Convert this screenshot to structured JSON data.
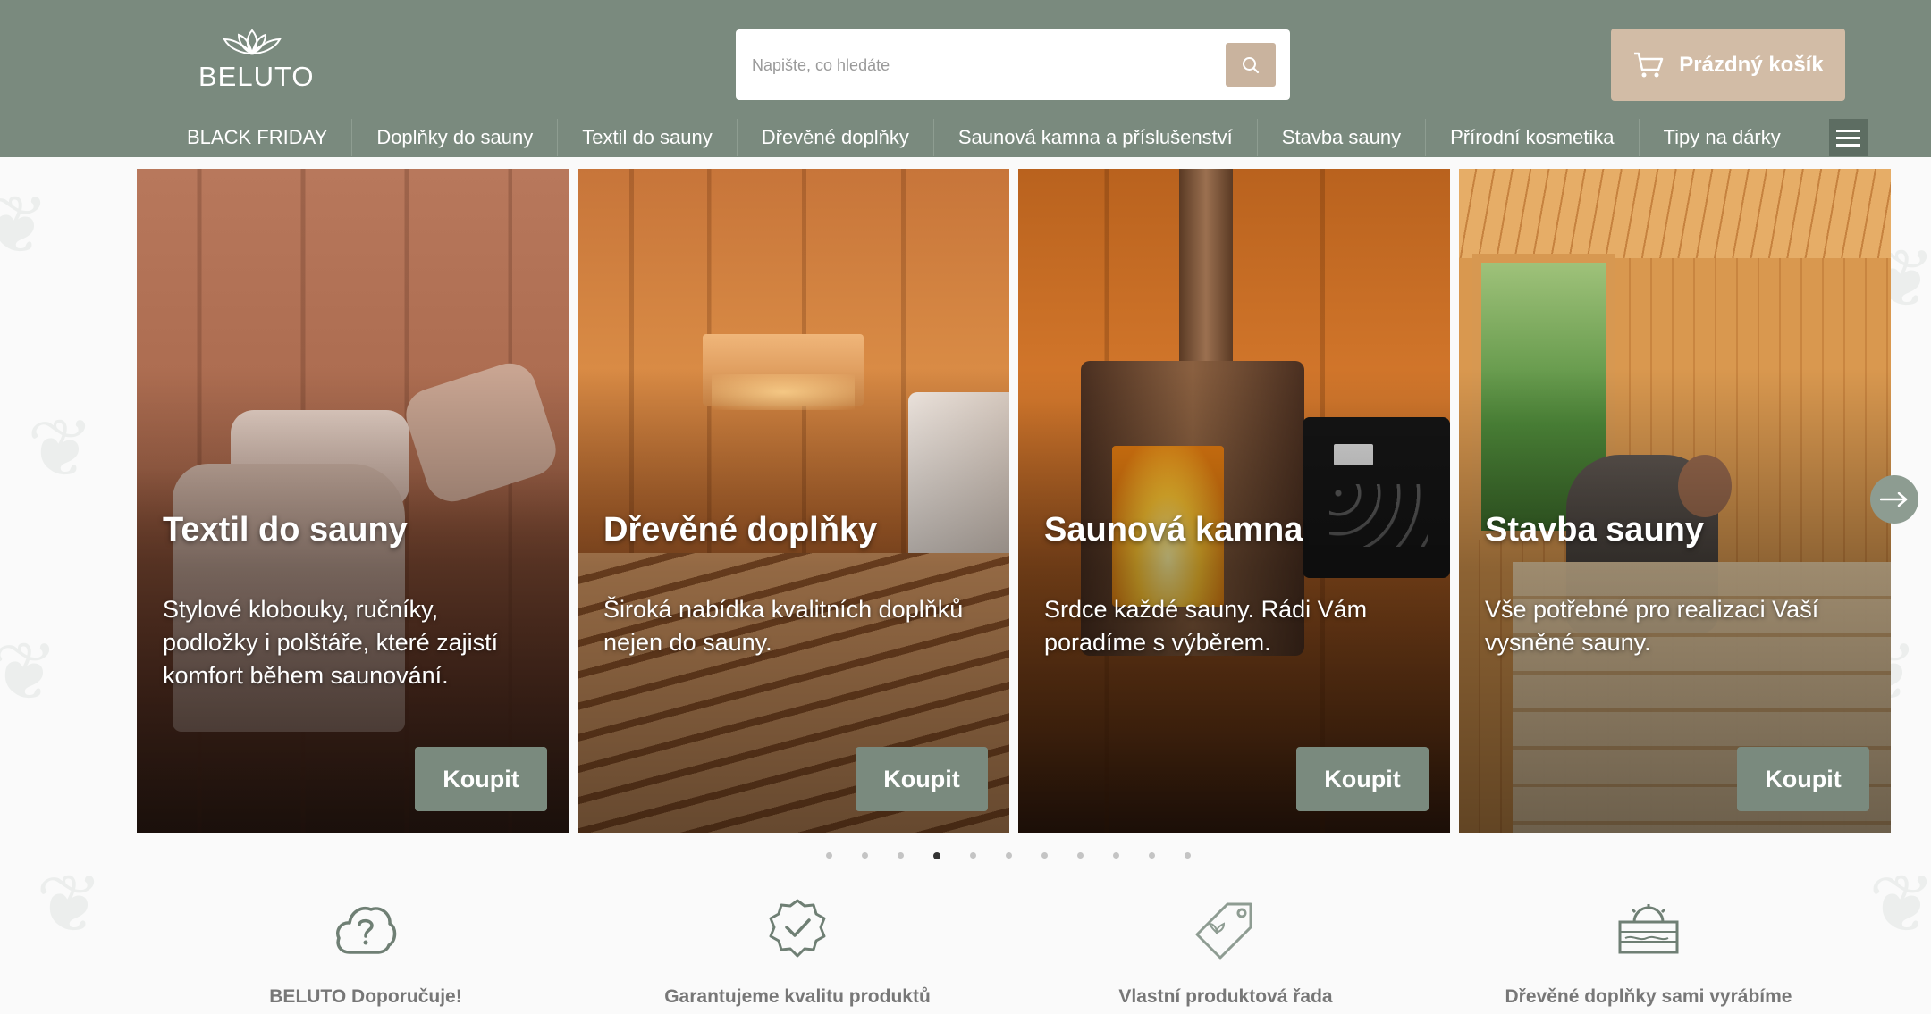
{
  "header": {
    "logo_text": "BELUTO",
    "search": {
      "placeholder": "Napište, co hledáte",
      "value": ""
    },
    "cart_label": "Prázdný košík"
  },
  "nav": {
    "items": [
      {
        "label": "BLACK FRIDAY"
      },
      {
        "label": "Doplňky do sauny"
      },
      {
        "label": "Textil do sauny"
      },
      {
        "label": "Dřevěné doplňky"
      },
      {
        "label": "Saunová kamna a příslušenství"
      },
      {
        "label": "Stavba sauny"
      },
      {
        "label": "Přírodní kosmetika"
      },
      {
        "label": "Tipy na dárky"
      }
    ]
  },
  "slides": [
    {
      "title": "Textil do sauny",
      "text": "Stylové klobouky, ručníky, podložky i polštáře, které zajistí komfort během saunování.",
      "button": "Koupit"
    },
    {
      "title": "Dřevěné doplňky",
      "text": "Široká nabídka kvalitních doplňků nejen do sauny.",
      "button": "Koupit"
    },
    {
      "title": "Saunová kamna",
      "text": "Srdce každé sauny. Rádi Vám poradíme s výběrem.",
      "button": "Koupit"
    },
    {
      "title": "Stavba sauny",
      "text": "Vše potřebné pro realizaci Vaší vysněné sauny.",
      "button": "Koupit"
    }
  ],
  "slider": {
    "dot_count": 11,
    "active_dot": 4
  },
  "features": [
    {
      "label": "BELUTO Doporučuje!",
      "icon": "question-cloud-icon"
    },
    {
      "label": "Garantujeme kvalitu produktů",
      "icon": "quality-badge-icon"
    },
    {
      "label": "Vlastní produktová řada",
      "icon": "tag-icon"
    },
    {
      "label": "Dřevěné doplňky sami vyrábíme",
      "icon": "sauna-wood-icon"
    }
  ],
  "colors": {
    "header_bg": "#7a8a7e",
    "accent_tan": "#d2bca6",
    "button_green": "#7a8a7e"
  }
}
